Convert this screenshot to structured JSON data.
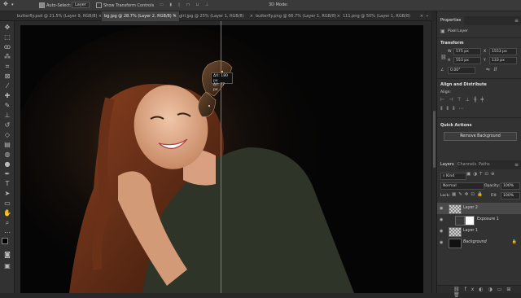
{
  "options_bar": {
    "auto_select_label": "Auto-Select:",
    "auto_select_value": "Layer",
    "show_transform_label": "Show Transform Controls",
    "mode_3d": "3D Mode:"
  },
  "tabs": [
    {
      "label": "butterfly.psd @ 21.5% (Layer 9, RGB/8)",
      "active": false
    },
    {
      "label": "bg.jpg @ 28.7% (Layer 2, RGB/8) *",
      "active": true
    },
    {
      "label": "girl.jpg @ 25% (Layer 1, RGB/8)",
      "active": false
    },
    {
      "label": "butterfly.png @ 66.7% (Layer 1, RGB/8)",
      "active": false
    },
    {
      "label": "111.png @ 50% (Layer 1, RGB/8)",
      "active": false
    }
  ],
  "canvas": {
    "tooltip_line1": "ΔX: 180 px",
    "tooltip_line2": "ΔY: 77 px"
  },
  "properties": {
    "tab": "Properties",
    "layer_type": "Pixel Layer",
    "transform_header": "Transform",
    "w_label": "W",
    "w_value": "575 px",
    "h_label": "H",
    "h_value": "553 px",
    "x_label": "X",
    "x_value": "1553 px",
    "y_label": "Y",
    "y_value": "133 px",
    "angle_value": "0.00°",
    "align_header": "Align and Distribute",
    "align_label": "Align:",
    "quick_actions_header": "Quick Actions",
    "remove_bg": "Remove Background"
  },
  "layers_panel": {
    "tabs": [
      "Layers",
      "Channels",
      "Paths"
    ],
    "kind": "Kind",
    "blend_mode": "Normal",
    "opacity_label": "Opacity:",
    "opacity_value": "100%",
    "lock_label": "Lock:",
    "fill_label": "Fill:",
    "fill_value": "100%",
    "layers": [
      {
        "name": "Layer 2",
        "selected": true
      },
      {
        "name": "Exposure 1",
        "selected": false
      },
      {
        "name": "Layer 1",
        "selected": false
      },
      {
        "name": "Background",
        "selected": false
      }
    ]
  },
  "colors": {
    "guide": "#c04ad0",
    "panel_bg": "#323232",
    "selected_layer": "#4a4a4a"
  }
}
